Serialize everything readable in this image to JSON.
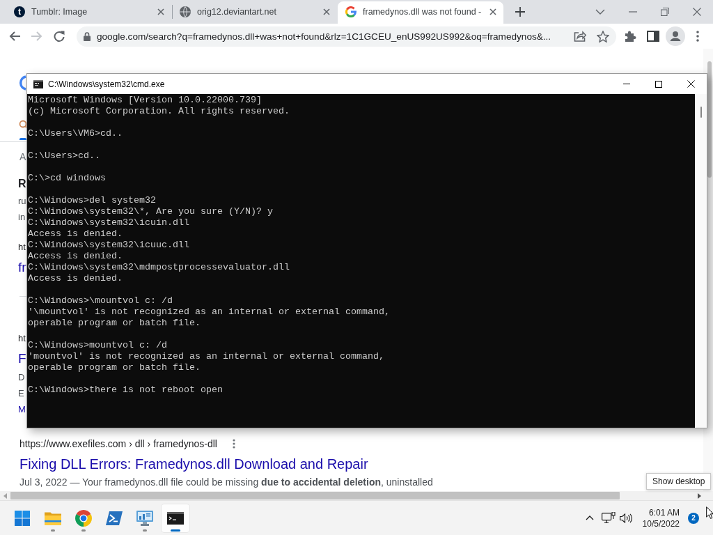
{
  "browser": {
    "tabs": [
      {
        "label": "Tumblr: Image",
        "favicon": {
          "kind": "letter",
          "text": "t"
        },
        "selected": false
      },
      {
        "label": "orig12.deviantart.net",
        "favicon": {
          "kind": "globe"
        },
        "selected": false
      },
      {
        "label": "framedynos.dll was not found -",
        "favicon": {
          "kind": "g"
        },
        "selected": true
      }
    ],
    "nav_buttons": [
      {
        "kind": "back",
        "disabled": false
      },
      {
        "kind": "forward",
        "disabled": true
      },
      {
        "kind": "reload",
        "disabled": false
      }
    ],
    "address": "google.com/search?q=framedynos.dll+was+not+found&rlz=1C1GCEU_enUS992US992&oq=framedynos&..."
  },
  "page": {
    "result_stats": "A",
    "covered_results": [
      {
        "items": [
          {
            "kind": "heading",
            "text": "R"
          },
          {
            "kind": "snippet",
            "text": "ru"
          },
          {
            "kind": "snippet",
            "text": "in"
          },
          {
            "kind": "url",
            "text": "ht"
          },
          {
            "kind": "title",
            "text": "fr"
          }
        ]
      },
      {
        "items": [
          {
            "kind": "url",
            "text": "ht"
          },
          {
            "kind": "title",
            "text": "F"
          },
          {
            "kind": "snippet",
            "text": "D"
          },
          {
            "kind": "snippet",
            "text": "E"
          },
          {
            "kind": "link",
            "text": "M"
          }
        ]
      }
    ],
    "results": [
      {
        "url": "https://www.exefiles.com › dll › framedynos-dll",
        "title": "Fixing DLL Errors: Framedynos.dll Download and Repair",
        "snippet": "Jul 3, 2022 — Your framedynos.dll file could be missing **due to accidental deletion**, uninstalled"
      }
    ],
    "tooltip": "Show desktop"
  },
  "console": {
    "title": "C:\\Windows\\system32\\cmd.exe",
    "blocks": [
      [
        "Microsoft Windows [Version 10.0.22000.739]",
        "(c) Microsoft Corporation. All rights reserved."
      ],
      [
        "C:\\Users\\VM6>cd.."
      ],
      [
        "C:\\Users>cd.."
      ],
      [
        "C:\\>cd windows"
      ],
      [
        "C:\\Windows>del system32",
        "C:\\Windows\\system32\\*, Are you sure (Y/N)? y",
        "C:\\Windows\\system32\\icuin.dll",
        "Access is denied.",
        "C:\\Windows\\system32\\icuuc.dll",
        "Access is denied.",
        "C:\\Windows\\system32\\mdmpostprocessevaluator.dll",
        "Access is denied."
      ],
      [
        "C:\\Windows>\\mountvol c: /d",
        "'\\mountvol' is not recognized as an internal or external command,",
        "operable program or batch file."
      ],
      [
        "C:\\Windows>mountvol c: /d",
        "'mountvol' is not recognized as an internal or external command,",
        "operable program or batch file."
      ],
      [
        "C:\\Windows>there is not reboot open"
      ]
    ]
  },
  "taskbar": {
    "apps": [
      {
        "kind": "start",
        "running": false,
        "selected": false
      },
      {
        "kind": "files",
        "running": true,
        "selected": false
      },
      {
        "kind": "chrome",
        "running": true,
        "selected": false
      },
      {
        "kind": "shell",
        "running": false,
        "selected": false
      },
      {
        "kind": "control",
        "running": true,
        "selected": false
      },
      {
        "kind": "terminal",
        "running": true,
        "selected": true
      }
    ],
    "time": "6:01 AM",
    "date": "10/5/2022",
    "notifications": "2"
  }
}
